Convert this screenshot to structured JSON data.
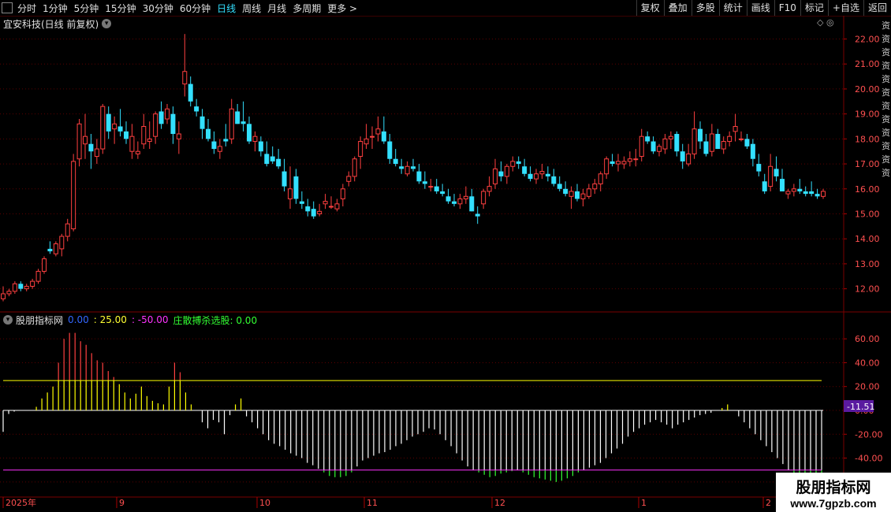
{
  "toolbar": {
    "periods": [
      "分时",
      "1分钟",
      "5分钟",
      "15分钟",
      "30分钟",
      "60分钟",
      "日线",
      "周线",
      "月线",
      "多周期",
      "更多 >"
    ],
    "active_index": 6,
    "right_buttons": [
      "复权",
      "叠加",
      "多股",
      "统计",
      "画线",
      "F10",
      "标记",
      "+自选",
      "返回"
    ]
  },
  "title": "宜安科技(日线 前复权)",
  "top_icons": "◇ ◎",
  "side_text": "资资资资资资资资资资资资",
  "indicator": {
    "name": "股朋指标网",
    "v1": "0.00",
    "v2": ": 25.00",
    "v3": ": -50.00",
    "v4": "庄散搏杀选股: 0.00",
    "current_label": "-11.51"
  },
  "watermark": {
    "line1": "股朋指标网",
    "line2": "www.7gpzb.com"
  },
  "price_axis": {
    "ticks": [
      "22.00",
      "21.00",
      "20.00",
      "19.00",
      "18.00",
      "17.00",
      "16.00",
      "15.00",
      "14.00",
      "13.00",
      "12.00"
    ]
  },
  "ind_axis": {
    "ticks": [
      "60.00",
      "40.00",
      "20.00",
      "0.00",
      "-20.00",
      "-40.00",
      "-60.00"
    ]
  },
  "x_axis": {
    "labels": [
      "2025年",
      "9",
      "10",
      "11",
      "12",
      "1",
      "2"
    ]
  },
  "colors": {
    "up": "#ff4040",
    "down": "#33e0ff",
    "yellow": "#ffff00",
    "purple": "#ff33ff",
    "green": "#33ff33"
  },
  "chart_data": {
    "type": "candlestick",
    "price_range": [
      11.2,
      22.3
    ],
    "candles": [
      [
        11.6,
        12.1,
        11.5,
        11.8
      ],
      [
        11.8,
        12.0,
        11.7,
        11.9
      ],
      [
        11.9,
        12.3,
        11.8,
        12.2
      ],
      [
        12.2,
        12.3,
        11.9,
        12.0
      ],
      [
        12.0,
        12.2,
        11.9,
        12.1
      ],
      [
        12.1,
        12.4,
        12.0,
        12.3
      ],
      [
        12.3,
        12.8,
        12.2,
        12.7
      ],
      [
        12.7,
        13.3,
        12.6,
        13.2
      ],
      [
        13.6,
        13.9,
        13.4,
        13.5
      ],
      [
        13.4,
        13.9,
        13.3,
        13.8
      ],
      [
        13.6,
        14.2,
        13.3,
        14.1
      ],
      [
        14.1,
        14.8,
        13.9,
        14.6
      ],
      [
        14.4,
        17.4,
        14.3,
        17.1
      ],
      [
        17.2,
        18.8,
        16.9,
        18.6
      ],
      [
        17.8,
        19.0,
        17.2,
        18.1
      ],
      [
        17.8,
        18.2,
        16.8,
        17.5
      ],
      [
        17.3,
        18.0,
        17.0,
        17.6
      ],
      [
        17.6,
        19.4,
        17.4,
        19.3
      ],
      [
        19.0,
        19.3,
        18.0,
        18.3
      ],
      [
        18.4,
        18.9,
        17.8,
        18.6
      ],
      [
        18.5,
        19.2,
        18.1,
        18.3
      ],
      [
        18.3,
        18.7,
        17.8,
        18.0
      ],
      [
        17.5,
        18.6,
        17.2,
        18.1
      ],
      [
        17.4,
        17.9,
        17.2,
        17.5
      ],
      [
        17.8,
        19.0,
        17.6,
        18.5
      ],
      [
        17.9,
        18.7,
        17.6,
        18.0
      ],
      [
        18.1,
        19.1,
        17.8,
        19.0
      ],
      [
        19.1,
        19.5,
        18.4,
        18.6
      ],
      [
        18.8,
        19.4,
        18.6,
        19.2
      ],
      [
        19.0,
        19.3,
        17.8,
        18.2
      ],
      [
        18.0,
        18.7,
        17.4,
        18.2
      ],
      [
        20.2,
        22.2,
        19.7,
        20.7
      ],
      [
        20.2,
        20.5,
        19.3,
        19.5
      ],
      [
        19.3,
        19.6,
        18.9,
        19.1
      ],
      [
        18.9,
        19.2,
        18.0,
        18.4
      ],
      [
        18.4,
        18.8,
        17.9,
        18.0
      ],
      [
        17.9,
        18.3,
        17.4,
        17.6
      ],
      [
        17.5,
        18.0,
        17.2,
        17.7
      ],
      [
        18.0,
        18.6,
        17.7,
        17.9
      ],
      [
        18.0,
        19.6,
        17.8,
        19.2
      ],
      [
        19.1,
        19.4,
        18.6,
        18.6
      ],
      [
        18.7,
        19.5,
        18.3,
        18.6
      ],
      [
        18.6,
        18.9,
        17.8,
        17.9
      ],
      [
        17.9,
        18.3,
        17.5,
        18.1
      ],
      [
        17.9,
        18.1,
        17.3,
        17.5
      ],
      [
        17.4,
        17.9,
        16.9,
        17.0
      ],
      [
        17.3,
        17.7,
        17.0,
        17.1
      ],
      [
        17.2,
        17.6,
        16.8,
        16.9
      ],
      [
        16.7,
        17.2,
        15.9,
        16.1
      ],
      [
        15.6,
        16.9,
        15.2,
        16.0
      ],
      [
        16.5,
        16.8,
        15.4,
        15.6
      ],
      [
        15.5,
        15.9,
        15.2,
        15.4
      ],
      [
        15.3,
        15.6,
        14.9,
        15.1
      ],
      [
        15.2,
        15.5,
        14.8,
        14.9
      ],
      [
        15.0,
        15.4,
        14.9,
        15.1
      ],
      [
        15.4,
        15.8,
        15.2,
        15.5
      ],
      [
        15.3,
        15.7,
        15.2,
        15.3
      ],
      [
        15.2,
        15.6,
        15.1,
        15.4
      ],
      [
        15.6,
        16.2,
        15.3,
        16.0
      ],
      [
        16.3,
        16.7,
        16.1,
        16.5
      ],
      [
        16.5,
        17.3,
        16.3,
        17.2
      ],
      [
        17.3,
        18.1,
        16.8,
        17.9
      ],
      [
        17.8,
        18.6,
        17.6,
        18.0
      ],
      [
        18.1,
        18.5,
        17.6,
        18.1
      ],
      [
        18.2,
        18.9,
        17.9,
        18.4
      ],
      [
        18.3,
        18.9,
        17.8,
        17.9
      ],
      [
        17.9,
        18.2,
        17.0,
        17.2
      ],
      [
        17.2,
        17.6,
        16.9,
        17.0
      ],
      [
        16.9,
        17.2,
        16.6,
        16.8
      ],
      [
        16.6,
        17.1,
        16.5,
        16.9
      ],
      [
        16.9,
        17.2,
        16.7,
        16.8
      ],
      [
        16.7,
        17.0,
        16.2,
        16.3
      ],
      [
        16.3,
        16.7,
        16.0,
        16.2
      ],
      [
        16.1,
        16.4,
        15.9,
        16.1
      ],
      [
        16.1,
        16.4,
        15.8,
        15.9
      ],
      [
        15.9,
        16.2,
        15.7,
        15.8
      ],
      [
        15.7,
        16.0,
        15.4,
        15.5
      ],
      [
        15.5,
        15.8,
        15.3,
        15.4
      ],
      [
        15.4,
        15.8,
        15.2,
        15.6
      ],
      [
        15.6,
        16.1,
        15.4,
        15.7
      ],
      [
        15.7,
        16.0,
        15.1,
        15.1
      ],
      [
        15.0,
        15.3,
        14.6,
        14.9
      ],
      [
        15.4,
        16.0,
        15.2,
        15.9
      ],
      [
        15.9,
        16.5,
        15.7,
        16.1
      ],
      [
        16.2,
        17.2,
        16.0,
        16.8
      ],
      [
        16.7,
        17.1,
        16.3,
        16.5
      ],
      [
        16.5,
        17.0,
        16.2,
        16.9
      ],
      [
        16.9,
        17.3,
        16.7,
        17.1
      ],
      [
        17.1,
        17.3,
        16.8,
        17.0
      ],
      [
        16.9,
        17.2,
        16.5,
        16.6
      ],
      [
        16.6,
        16.9,
        16.3,
        16.4
      ],
      [
        16.4,
        16.8,
        16.2,
        16.6
      ],
      [
        16.6,
        17.0,
        16.4,
        16.7
      ],
      [
        16.6,
        16.9,
        16.3,
        16.5
      ],
      [
        16.5,
        16.8,
        16.1,
        16.2
      ],
      [
        16.2,
        16.5,
        15.9,
        16.0
      ],
      [
        16.0,
        16.3,
        15.7,
        15.8
      ],
      [
        15.7,
        16.1,
        15.2,
        15.9
      ],
      [
        15.9,
        16.2,
        15.5,
        15.6
      ],
      [
        15.6,
        16.0,
        15.3,
        15.8
      ],
      [
        15.7,
        16.2,
        15.6,
        16.0
      ],
      [
        16.0,
        16.4,
        15.8,
        16.2
      ],
      [
        16.2,
        16.7,
        15.9,
        16.6
      ],
      [
        16.6,
        17.3,
        16.4,
        17.2
      ],
      [
        17.1,
        17.4,
        16.9,
        17.0
      ],
      [
        17.0,
        17.4,
        16.7,
        17.1
      ],
      [
        17.0,
        17.3,
        16.8,
        17.1
      ],
      [
        17.1,
        17.5,
        16.9,
        17.2
      ],
      [
        17.2,
        17.6,
        16.9,
        17.2
      ],
      [
        17.3,
        18.4,
        17.1,
        18.1
      ],
      [
        18.1,
        18.3,
        17.8,
        17.9
      ],
      [
        17.9,
        18.1,
        17.4,
        17.5
      ],
      [
        17.5,
        17.8,
        17.3,
        17.7
      ],
      [
        17.6,
        18.2,
        17.4,
        18.0
      ],
      [
        18.0,
        18.3,
        17.6,
        18.1
      ],
      [
        18.2,
        18.3,
        17.3,
        17.5
      ],
      [
        17.5,
        17.8,
        16.8,
        17.1
      ],
      [
        17.0,
        17.8,
        16.9,
        17.4
      ],
      [
        17.4,
        19.1,
        17.2,
        18.4
      ],
      [
        18.4,
        18.7,
        17.6,
        17.9
      ],
      [
        17.9,
        18.2,
        17.3,
        17.4
      ],
      [
        17.5,
        18.6,
        17.3,
        18.2
      ],
      [
        18.2,
        18.4,
        17.6,
        17.6
      ],
      [
        17.6,
        18.1,
        17.4,
        17.9
      ],
      [
        17.9,
        18.3,
        17.7,
        18.1
      ],
      [
        18.3,
        19.0,
        17.9,
        18.5
      ],
      [
        18.0,
        18.3,
        17.9,
        18.0
      ],
      [
        18.0,
        18.2,
        17.6,
        17.7
      ],
      [
        17.8,
        18.0,
        16.9,
        17.2
      ],
      [
        17.0,
        17.4,
        16.5,
        16.7
      ],
      [
        16.3,
        16.6,
        15.8,
        15.9
      ],
      [
        16.1,
        17.4,
        15.9,
        16.9
      ],
      [
        16.8,
        17.3,
        16.3,
        16.5
      ],
      [
        16.4,
        16.8,
        15.9,
        15.9
      ],
      [
        15.8,
        16.0,
        15.6,
        15.9
      ],
      [
        15.9,
        16.2,
        15.7,
        16.0
      ],
      [
        16.0,
        16.4,
        15.8,
        15.9
      ],
      [
        15.9,
        16.1,
        15.7,
        15.8
      ],
      [
        15.9,
        16.3,
        15.7,
        15.8
      ],
      [
        15.8,
        16.0,
        15.6,
        15.7
      ],
      [
        15.7,
        16.0,
        15.6,
        15.9
      ]
    ],
    "indicator_values": [
      -18,
      -3,
      -1,
      0,
      0,
      0,
      3,
      10,
      15,
      20,
      40,
      60,
      65,
      65,
      58,
      55,
      48,
      42,
      40,
      33,
      28,
      22,
      15,
      10,
      14,
      20,
      12,
      8,
      6,
      5,
      20,
      40,
      32,
      15,
      5,
      0,
      -10,
      -15,
      -8,
      -10,
      -20,
      -4,
      5,
      10,
      -5,
      -10,
      -15,
      -20,
      -25,
      -28,
      -30,
      -33,
      -36,
      -38,
      -40,
      -44,
      -46,
      -49,
      -52,
      -55,
      -56,
      -56,
      -55,
      -52,
      -47,
      -42,
      -40,
      -38,
      -36,
      -35,
      -33,
      -30,
      -28,
      -25,
      -22,
      -20,
      -18,
      -15,
      -16,
      -20,
      -25,
      -30,
      -36,
      -42,
      -47,
      -50,
      -52,
      -54,
      -56,
      -55,
      -53,
      -52,
      -51,
      -50,
      -52,
      -54,
      -56,
      -57,
      -58,
      -59,
      -60,
      -59,
      -57,
      -55,
      -52,
      -50,
      -48,
      -46,
      -44,
      -40,
      -36,
      -32,
      -28,
      -22,
      -18,
      -15,
      -12,
      -10,
      -8,
      -10,
      -12,
      -15,
      -12,
      -10,
      -8,
      -6,
      -4,
      -3,
      -2,
      0,
      2,
      5,
      0,
      -5,
      -10,
      -15,
      -20,
      -25,
      -30,
      -35,
      -40,
      -45,
      -50,
      -55,
      -58,
      -60,
      -58,
      -56,
      -55
    ],
    "indicator_range": [
      -72,
      72
    ],
    "line_yellow": 25,
    "line_purple": -50
  }
}
